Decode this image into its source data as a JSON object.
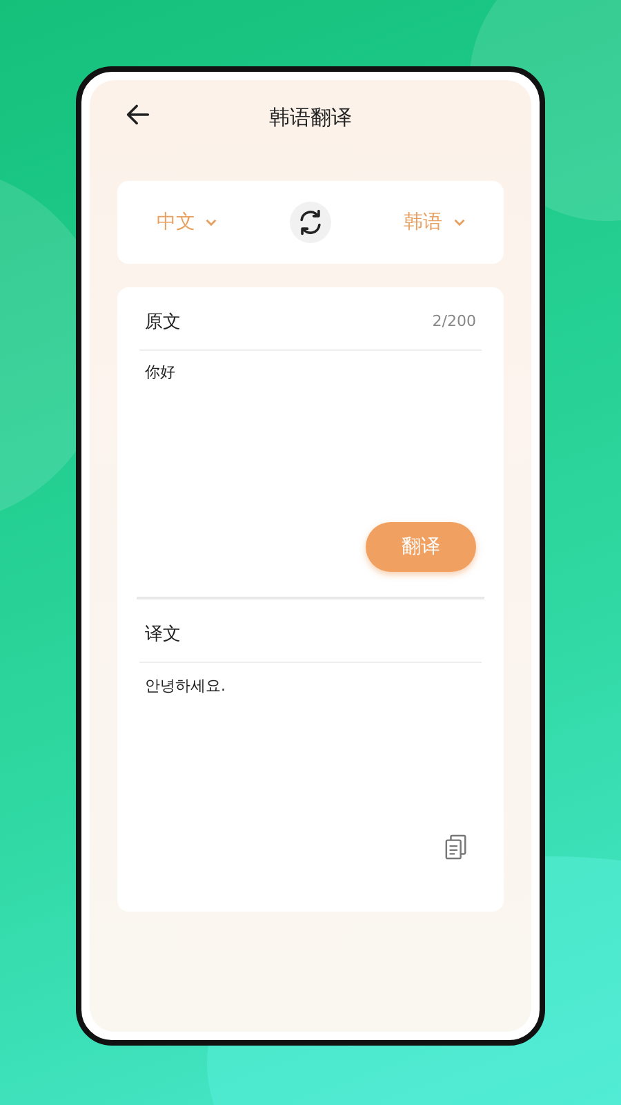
{
  "header": {
    "title": "韩语翻译"
  },
  "languages": {
    "source": "中文",
    "target": "韩语"
  },
  "source": {
    "label": "原文",
    "counter": "2/200",
    "value": "你好"
  },
  "translate_button": "翻译",
  "result": {
    "label": "译文",
    "value": "안녕하세요."
  }
}
